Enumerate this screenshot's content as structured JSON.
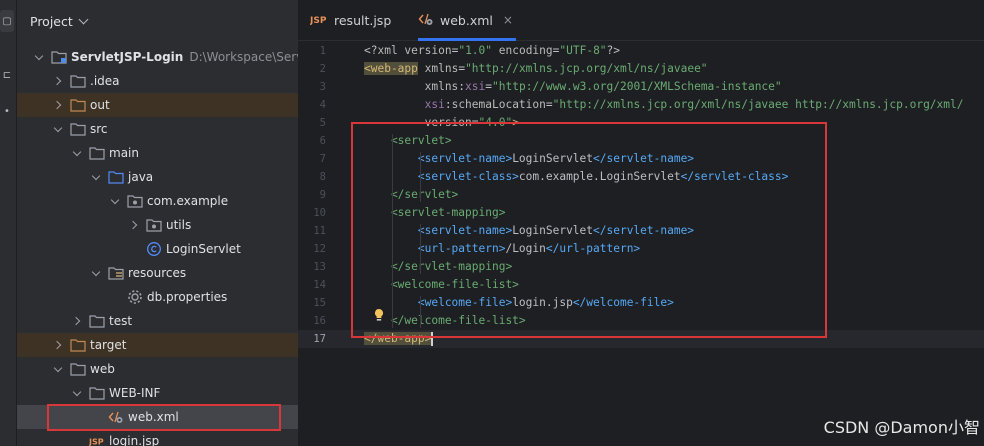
{
  "project_panel": {
    "title": "Project",
    "tree": [
      {
        "label": "ServletJSP-Login",
        "path": "D:\\Workspace\\ServletJSP",
        "icon": "module-folder-icon",
        "depth": 0,
        "expanded": true,
        "excluded": false,
        "bold": true
      },
      {
        "label": ".idea",
        "icon": "folder-icon",
        "depth": 1,
        "expanded": false,
        "excluded": false
      },
      {
        "label": "out",
        "icon": "excluded-folder-icon",
        "depth": 1,
        "expanded": false,
        "excluded": true
      },
      {
        "label": "src",
        "icon": "folder-icon",
        "depth": 1,
        "expanded": true,
        "excluded": false
      },
      {
        "label": "main",
        "icon": "folder-icon",
        "depth": 2,
        "expanded": true,
        "excluded": false
      },
      {
        "label": "java",
        "icon": "source-folder-icon",
        "depth": 3,
        "expanded": true,
        "excluded": false
      },
      {
        "label": "com.example",
        "icon": "package-icon",
        "depth": 4,
        "expanded": true,
        "excluded": false
      },
      {
        "label": "utils",
        "icon": "package-icon",
        "depth": 5,
        "expanded": false,
        "excluded": false
      },
      {
        "label": "LoginServlet",
        "icon": "class-icon",
        "depth": 5,
        "expanded": null,
        "excluded": false
      },
      {
        "label": "resources",
        "icon": "resources-folder-icon",
        "depth": 3,
        "expanded": true,
        "excluded": false
      },
      {
        "label": "db.properties",
        "icon": "properties-file-icon",
        "depth": 4,
        "expanded": null,
        "excluded": false
      },
      {
        "label": "test",
        "icon": "folder-icon",
        "depth": 2,
        "expanded": false,
        "excluded": false
      },
      {
        "label": "target",
        "icon": "excluded-folder-icon",
        "depth": 1,
        "expanded": false,
        "excluded": true
      },
      {
        "label": "web",
        "icon": "folder-icon",
        "depth": 1,
        "expanded": true,
        "excluded": false
      },
      {
        "label": "WEB-INF",
        "icon": "folder-icon",
        "depth": 2,
        "expanded": true,
        "excluded": false
      },
      {
        "label": "web.xml",
        "icon": "xml-file-icon",
        "depth": 3,
        "expanded": null,
        "excluded": false,
        "selected": true
      },
      {
        "label": "login.jsp",
        "icon": "jsp-file-icon",
        "depth": 2,
        "expanded": null,
        "excluded": false
      }
    ]
  },
  "editor": {
    "tabs": [
      {
        "label": "result.jsp",
        "icon": "jsp-file-icon",
        "active": false
      },
      {
        "label": "web.xml",
        "icon": "xml-file-icon",
        "active": true,
        "close": "×"
      }
    ],
    "current_line": 17,
    "lines": [
      {
        "n": "1",
        "segs": [
          [
            "t-text",
            "<?"
          ],
          [
            "t-attr",
            "xml version"
          ],
          [
            "t-text",
            "="
          ],
          [
            "t-val",
            "\"1.0\""
          ],
          [
            "t-attr",
            " encoding"
          ],
          [
            "t-text",
            "="
          ],
          [
            "t-val",
            "\"UTF-8\""
          ],
          [
            "t-text",
            "?>"
          ]
        ]
      },
      {
        "n": "2",
        "segs": [
          [
            "t-tag hl-tag",
            "<web-app"
          ],
          [
            "t-attr",
            " xmlns"
          ],
          [
            "t-text",
            "="
          ],
          [
            "t-val",
            "\"http://xmlns.jcp.org/xml/ns/javaee\""
          ]
        ]
      },
      {
        "n": "3",
        "segs": [
          [
            "t-attr",
            "         xmlns"
          ],
          [
            "t-text",
            ":"
          ],
          [
            "t-ns",
            "xsi"
          ],
          [
            "t-text",
            "="
          ],
          [
            "t-val",
            "\"http://www.w3.org/2001/XMLSchema-instance\""
          ]
        ]
      },
      {
        "n": "4",
        "segs": [
          [
            "t-ns",
            "         xsi"
          ],
          [
            "t-text",
            ":"
          ],
          [
            "t-attr",
            "schemaLocation"
          ],
          [
            "t-text",
            "="
          ],
          [
            "t-val",
            "\"http://xmlns.jcp.org/xml/ns/javaee http://xmlns.jcp.org/xml/"
          ]
        ]
      },
      {
        "n": "5",
        "segs": [
          [
            "t-attr",
            "         version"
          ],
          [
            "t-text",
            "="
          ],
          [
            "t-val",
            "\"4.0\""
          ],
          [
            "t-tag",
            ">"
          ]
        ]
      },
      {
        "n": "6",
        "segs": [
          [
            "t-xmltag2",
            "    <servlet>"
          ]
        ]
      },
      {
        "n": "7",
        "segs": [
          [
            "t-xmltag",
            "        <servlet-name>"
          ],
          [
            "t-text",
            "LoginServlet"
          ],
          [
            "t-xmltag",
            "</servlet-name>"
          ]
        ]
      },
      {
        "n": "8",
        "segs": [
          [
            "t-xmltag",
            "        <servlet-class>"
          ],
          [
            "t-text",
            "com.example.LoginServlet"
          ],
          [
            "t-xmltag",
            "</servlet-class>"
          ]
        ]
      },
      {
        "n": "9",
        "segs": [
          [
            "t-xmltag2",
            "    </servlet>"
          ]
        ]
      },
      {
        "n": "10",
        "segs": [
          [
            "t-xmltag2",
            "    <servlet-mapping>"
          ]
        ]
      },
      {
        "n": "11",
        "segs": [
          [
            "t-xmltag",
            "        <servlet-name>"
          ],
          [
            "t-text",
            "LoginServlet"
          ],
          [
            "t-xmltag",
            "</servlet-name>"
          ]
        ]
      },
      {
        "n": "12",
        "segs": [
          [
            "t-xmltag",
            "        <url-pattern>"
          ],
          [
            "t-text",
            "/Login"
          ],
          [
            "t-xmltag",
            "</url-pattern>"
          ]
        ]
      },
      {
        "n": "13",
        "segs": [
          [
            "t-xmltag2",
            "    </servlet-mapping>"
          ]
        ]
      },
      {
        "n": "14",
        "segs": [
          [
            "t-xmltag2",
            "    <welcome-file-list>"
          ]
        ]
      },
      {
        "n": "15",
        "segs": [
          [
            "t-xmltag",
            "        <welcome-file>"
          ],
          [
            "t-text",
            "login.jsp"
          ],
          [
            "t-xmltag",
            "</welcome-file>"
          ]
        ]
      },
      {
        "n": "16",
        "segs": [
          [
            "t-xmltag2",
            "    </welcome-file-list>"
          ]
        ]
      },
      {
        "n": "17",
        "segs": [
          [
            "t-tag hl-tag",
            "</web-app>"
          ]
        ]
      }
    ]
  },
  "watermark": "CSDN @Damon小智",
  "colors": {
    "highlight_box": "#d9363a",
    "accent": "#3574f0"
  }
}
